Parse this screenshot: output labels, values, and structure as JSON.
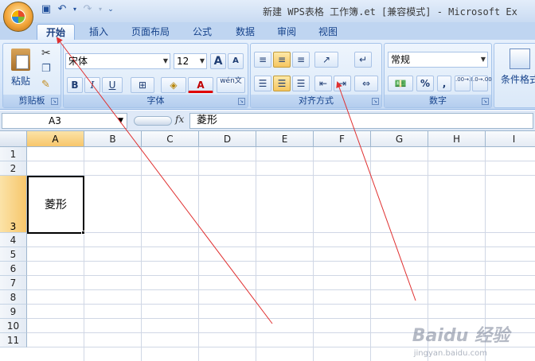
{
  "titlebar": {
    "title": "新建 WPS表格 工作簿.et  [兼容模式] - Microsoft Ex"
  },
  "tabs": [
    "开始",
    "插入",
    "页面布局",
    "公式",
    "数据",
    "审阅",
    "视图"
  ],
  "ribbon": {
    "clipboard": {
      "paste_label": "粘贴",
      "group_label": "剪贴板"
    },
    "font": {
      "font_name": "宋体",
      "font_size": "12",
      "grow_label": "A",
      "shrink_label": "A",
      "bold_label": "B",
      "italic_label": "I",
      "underline_label": "U",
      "font_color_label": "A",
      "phonetic_label": "wén文",
      "group_label": "字体"
    },
    "alignment": {
      "group_label": "对齐方式"
    },
    "number": {
      "format": "常规",
      "percent_label": "%",
      "comma_label": ",",
      "inc_decimal": ".00→.0",
      "dec_decimal": ".0→.00",
      "group_label": "数字"
    },
    "styles": {
      "conditional_label": "条件格式"
    }
  },
  "formula_bar": {
    "name_box": "A3",
    "fx_label": "fx",
    "content": "菱形"
  },
  "grid": {
    "columns": [
      "A",
      "B",
      "C",
      "D",
      "E",
      "F",
      "G",
      "H",
      "I"
    ],
    "rows": [
      "1",
      "2",
      "3",
      "4",
      "5",
      "6",
      "7",
      "8",
      "9",
      "10",
      "11"
    ],
    "active_cell": {
      "ref": "A3",
      "value": "菱形"
    }
  },
  "watermark": {
    "text": "Baidu 经验",
    "sub": "jingyan.baidu.com"
  },
  "colors": {
    "ribbon_bg": "#d7e6f9",
    "selected_header": "#f7c66b",
    "arrow": "#e03030"
  }
}
